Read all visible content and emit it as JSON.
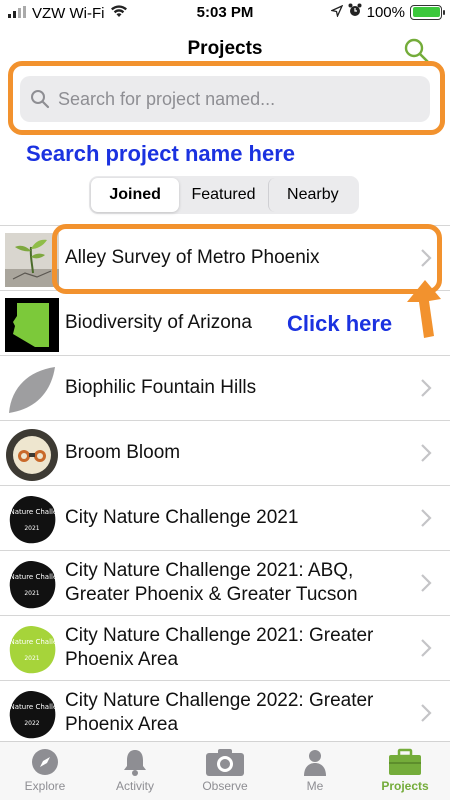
{
  "status_bar": {
    "carrier": "VZW Wi-Fi",
    "time": "5:03 PM",
    "battery": "100%"
  },
  "nav": {
    "title": "Projects",
    "icon": "search-icon"
  },
  "search": {
    "placeholder": "Search for project named..."
  },
  "annotations": {
    "search_hint": "Search project name here",
    "click_hint": "Click here",
    "highlight_color": "#f2922e",
    "text_color": "#1b32e0"
  },
  "segments": [
    {
      "label": "Joined",
      "active": true
    },
    {
      "label": "Featured",
      "active": false
    },
    {
      "label": "Nearby",
      "active": false
    }
  ],
  "projects": [
    {
      "name": "Alley Survey of Metro Phoenix",
      "icon": "alley-survey-thumbnail"
    },
    {
      "name": "Biodiversity of Arizona",
      "icon": "arizona-shape-thumbnail"
    },
    {
      "name": "Biophilic Fountain Hills",
      "icon": "leaf-thumbnail"
    },
    {
      "name": "Broom Bloom",
      "icon": "ecoquest-badge-thumbnail"
    },
    {
      "name": "City Nature Challenge 2021",
      "icon": "cnc-logo-thumbnail"
    },
    {
      "name": "City Nature Challenge 2021: ABQ, Greater Phoenix & Greater Tucson",
      "icon": "cnc-logo-thumbnail"
    },
    {
      "name": "City Nature Challenge 2021: Greater Phoenix Area",
      "icon": "cnc-green-logo-thumbnail"
    },
    {
      "name": "City Nature Challenge 2022: Greater Phoenix Area",
      "icon": "cnc-logo-thumbnail"
    }
  ],
  "cnc_logo_text": "City Nature Challenge",
  "tabs": [
    {
      "label": "Explore",
      "icon": "compass-icon",
      "active": false
    },
    {
      "label": "Activity",
      "icon": "bell-icon",
      "active": false
    },
    {
      "label": "Observe",
      "icon": "camera-icon",
      "active": false
    },
    {
      "label": "Me",
      "icon": "person-icon",
      "active": false
    },
    {
      "label": "Projects",
      "icon": "briefcase-icon",
      "active": true
    }
  ],
  "colors": {
    "accent": "#74ac3a",
    "inactive": "#8e8e93"
  }
}
